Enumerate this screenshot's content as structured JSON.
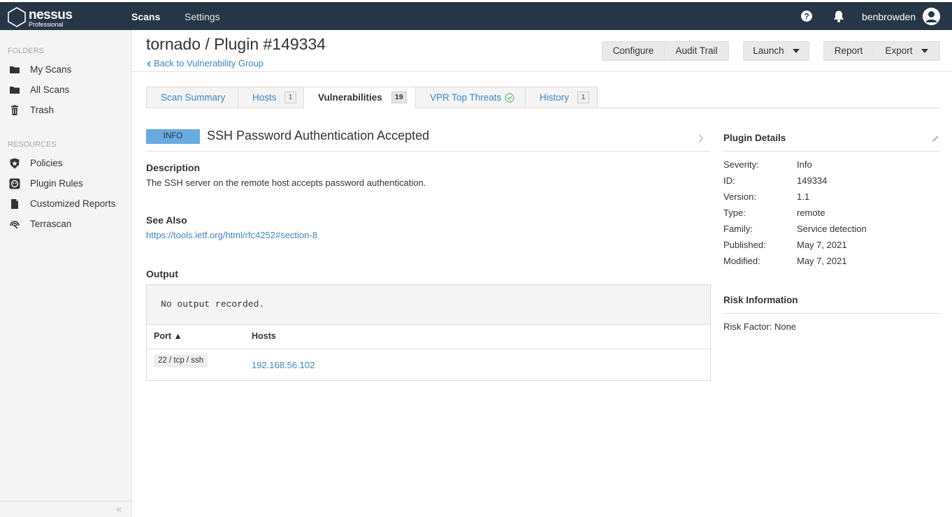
{
  "topbar": {
    "logo_name": "nessus",
    "logo_sub": "Professional",
    "nav_scans": "Scans",
    "nav_settings": "Settings",
    "username": "benbrowden",
    "bg_color": "#263646"
  },
  "sidebar": {
    "folders_heading": "FOLDERS",
    "folders": [
      {
        "label": "My Scans",
        "icon": "folder-icon"
      },
      {
        "label": "All Scans",
        "icon": "folder-icon"
      },
      {
        "label": "Trash",
        "icon": "trash-icon"
      }
    ],
    "resources_heading": "RESOURCES",
    "resources": [
      {
        "label": "Policies",
        "icon": "policy-shield-icon"
      },
      {
        "label": "Plugin Rules",
        "icon": "plugin-rules-icon"
      },
      {
        "label": "Customized Reports",
        "icon": "document-icon"
      },
      {
        "label": "Terrascan",
        "icon": "terrascan-icon"
      }
    ],
    "collapse_glyph": "«"
  },
  "header": {
    "title": "tornado / Plugin #149334",
    "back_link": "Back to Vulnerability Group",
    "buttons": {
      "configure": "Configure",
      "audit_trail": "Audit Trail",
      "launch": "Launch",
      "report": "Report",
      "export": "Export"
    }
  },
  "tabs": [
    {
      "label": "Scan Summary",
      "count": null
    },
    {
      "label": "Hosts",
      "count": "1"
    },
    {
      "label": "Vulnerabilities",
      "count": "19",
      "active": true
    },
    {
      "label": "VPR Top Threats",
      "count": null
    },
    {
      "label": "History",
      "count": "1"
    }
  ],
  "vuln": {
    "severity": "INFO",
    "severity_color": "#67ACE1",
    "title": "SSH Password Authentication Accepted",
    "description_heading": "Description",
    "description": "The SSH server on the remote host accepts password authentication.",
    "see_also_heading": "See Also",
    "see_also_link": "https://tools.ietf.org/html/rfc4252#section-8",
    "output_heading": "Output",
    "output_text": "No output recorded.",
    "table_headers": {
      "port": "Port ▲",
      "hosts": "Hosts"
    },
    "rows": [
      {
        "port": "22 / tcp / ssh",
        "host": "192.168.56.102"
      }
    ]
  },
  "plugin_details": {
    "heading": "Plugin Details",
    "fields": [
      {
        "key": "Severity:",
        "value": "Info"
      },
      {
        "key": "ID:",
        "value": "149334"
      },
      {
        "key": "Version:",
        "value": "1.1"
      },
      {
        "key": "Type:",
        "value": "remote"
      },
      {
        "key": "Family:",
        "value": "Service detection"
      },
      {
        "key": "Published:",
        "value": "May 7, 2021"
      },
      {
        "key": "Modified:",
        "value": "May 7, 2021"
      }
    ]
  },
  "risk": {
    "heading": "Risk Information",
    "text": "Risk Factor: None"
  },
  "colors": {
    "link": "#3c85c4",
    "accent_check": "#5cb85c"
  }
}
